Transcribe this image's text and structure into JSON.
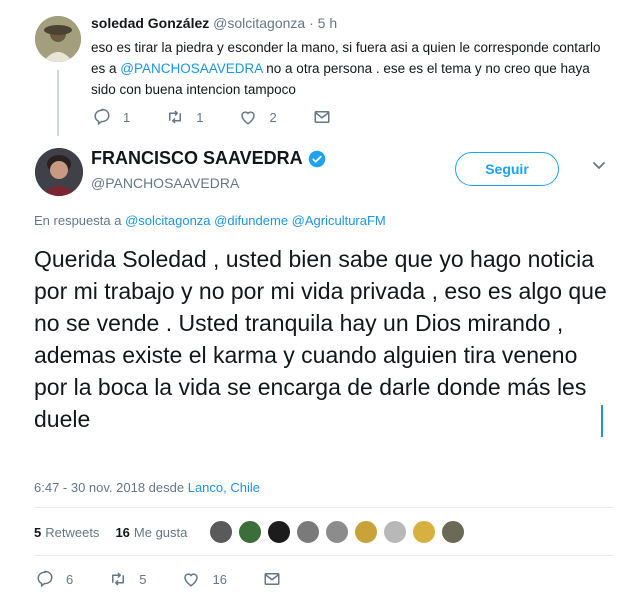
{
  "reply_tweet": {
    "author_name": "soledad González",
    "handle": "@solcitagonza",
    "separator": " · ",
    "time": "5 h",
    "text_before": "eso es tirar la piedra y esconder la mano, si fuera asi a quien le corresponde contarlo es a ",
    "mention": "@PANCHOSAAVEDRA",
    "text_after": "  no a otra persona . ese es el tema y no creo que haya sido con buena intencion tampoco",
    "actions": {
      "replies": "1",
      "retweets": "1",
      "likes": "2"
    }
  },
  "main_tweet": {
    "author_name": "FRANCISCO SAAVEDRA",
    "handle": "@PANCHOSAAVEDRA",
    "follow_label": "Seguir",
    "in_reply_prefix": "En respuesta a ",
    "in_reply_mentions": "@solcitagonza @difundeme @AgriculturaFM",
    "text": "Querida Soledad , usted bien sabe que yo hago noticia por mi trabajo y no por mi vida privada , eso es algo que no se vende . Usted tranquila hay un Dios mirando , ademas existe el karma y cuando alguien tira veneno por la boca la vida se encarga de darle donde más les duele",
    "timestamp_prefix": "6:47 - 30 nov. 2018 desde ",
    "location": "Lanco, Chile",
    "retweets_count": "5",
    "retweets_label": "Retweets",
    "likes_count": "16",
    "likes_label": "Me gusta",
    "actions": {
      "replies": "6",
      "retweets": "5",
      "likes": "16"
    }
  },
  "liker_colors": [
    "#5a5a5a",
    "#3b6e3b",
    "#1c1c1c",
    "#7a7a7a",
    "#8c8c8c",
    "#c9a33a",
    "#b8b8b8",
    "#d8b040",
    "#6b6b55"
  ],
  "colors": {
    "accent": "#1da1f2",
    "link": "#1b95e0",
    "muted": "#657786",
    "text": "#14171a"
  },
  "icons": [
    "reply-icon",
    "retweet-icon",
    "like-icon",
    "message-icon",
    "verified-badge-icon",
    "chevron-down-icon"
  ]
}
